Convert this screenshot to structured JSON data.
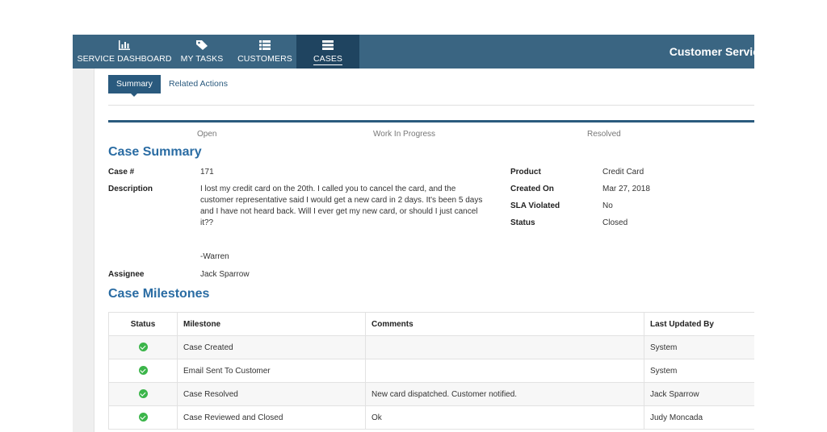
{
  "nav": {
    "items": [
      {
        "label": "SERVICE DASHBOARD",
        "icon": "bar-chart-icon"
      },
      {
        "label": "MY TASKS",
        "icon": "tag-icon"
      },
      {
        "label": "CUSTOMERS",
        "icon": "list-icon"
      },
      {
        "label": "CASES",
        "icon": "stack-icon"
      }
    ],
    "active": "CASES",
    "app_title": "Customer Servic"
  },
  "tabs": [
    {
      "label": "Summary",
      "active": true
    },
    {
      "label": "Related Actions",
      "active": false
    }
  ],
  "progress": {
    "stages": [
      "Open",
      "Work In Progress",
      "Resolved"
    ]
  },
  "case_summary": {
    "title": "Case Summary",
    "case_number_label": "Case #",
    "case_number": "171",
    "description_label": "Description",
    "description_lines": [
      "I lost my credit card on the 20th. I called you to cancel the card, and the",
      "customer representative said I would get a new card in 2 days. It's been 5 days",
      "and I have not heard back. Will I ever get my new card, or should I just cancel",
      "it??"
    ],
    "signature": "-Warren",
    "assignee_label": "Assignee",
    "assignee": "Jack Sparrow",
    "product_label": "Product",
    "product": "Credit Card",
    "created_on_label": "Created On",
    "created_on": "Mar 27, 2018",
    "sla_label": "SLA Violated",
    "sla": "No",
    "status_label": "Status",
    "status": "Closed"
  },
  "milestones": {
    "title": "Case Milestones",
    "columns": [
      "Status",
      "Milestone",
      "Comments",
      "Last Updated By"
    ],
    "rows": [
      {
        "milestone": "Case Created",
        "comments": "",
        "updated_by": "System"
      },
      {
        "milestone": "Email Sent To Customer",
        "comments": "",
        "updated_by": "System"
      },
      {
        "milestone": "Case Resolved",
        "comments": "New card dispatched. Customer notified.",
        "updated_by": "Jack Sparrow"
      },
      {
        "milestone": "Case Reviewed and Closed",
        "comments": "Ok",
        "updated_by": "Judy Moncada"
      }
    ]
  },
  "colors": {
    "nav_bg": "#3a6582",
    "nav_active": "#1f4460",
    "accent": "#2a6ca3",
    "check": "#3bb54a"
  }
}
